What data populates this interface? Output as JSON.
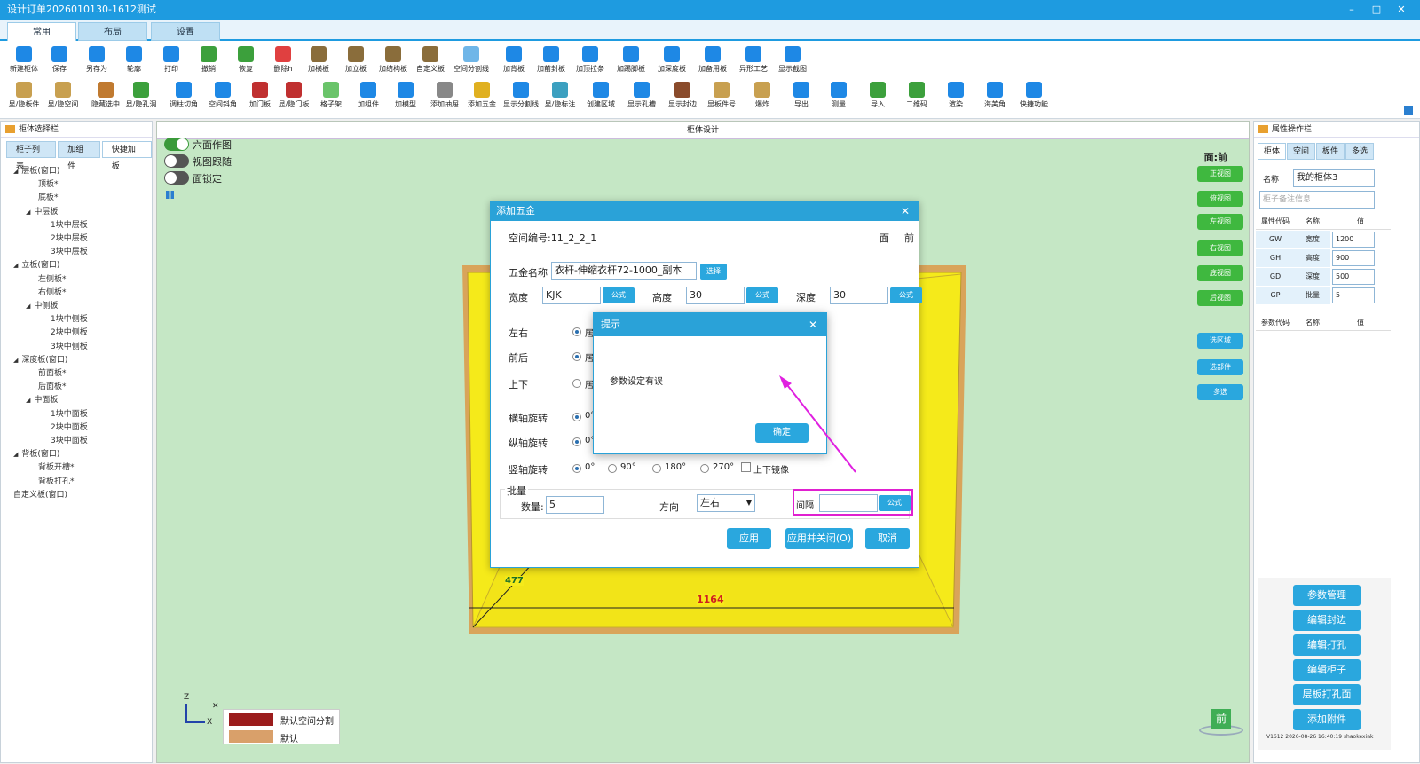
{
  "window": {
    "title": "设计订单2026010130-1612测试",
    "controls": [
      "–",
      "□",
      "✕"
    ]
  },
  "main_tabs": [
    {
      "label": "常用"
    },
    {
      "label": "布局"
    },
    {
      "label": "设置"
    }
  ],
  "toolbar_row1": [
    {
      "label": "新建柜体",
      "icon": "new-cabinet-icon",
      "color": "#1e88e5"
    },
    {
      "label": "保存",
      "icon": "save-icon",
      "color": "#1e88e5"
    },
    {
      "label": "另存为",
      "icon": "save-as-icon",
      "color": "#1e88e5"
    },
    {
      "label": "轮廓",
      "icon": "outline-icon",
      "color": "#1e88e5"
    },
    {
      "label": "打印",
      "icon": "print-icon",
      "color": "#1e88e5"
    },
    {
      "label": "撤销",
      "icon": "undo-icon",
      "color": "#3ca03c"
    },
    {
      "label": "恢复",
      "icon": "redo-icon",
      "color": "#3ca03c"
    },
    {
      "label": "删除h",
      "icon": "delete-icon",
      "color": "#e04040"
    },
    {
      "label": "加横板",
      "icon": "add-shelf-icon",
      "color": "#8a6d3b"
    },
    {
      "label": "加立板",
      "icon": "add-vertical-board-icon",
      "color": "#8a6d3b"
    },
    {
      "label": "加结构板",
      "icon": "add-structure-board-icon",
      "color": "#8a6d3b"
    },
    {
      "label": "自定义板",
      "icon": "custom-board-icon",
      "color": "#8a6d3b"
    },
    {
      "label": "空间分割线",
      "icon": "space-divider-icon",
      "color": "#6fb6e8"
    },
    {
      "label": "加背板",
      "icon": "add-back-panel-icon",
      "color": "#1e88e5"
    },
    {
      "label": "加前封板",
      "icon": "add-front-seal-icon",
      "color": "#1e88e5"
    },
    {
      "label": "加顶拉条",
      "icon": "add-top-strip-icon",
      "color": "#1e88e5"
    },
    {
      "label": "加踢脚板",
      "icon": "add-kickboard-icon",
      "color": "#1e88e5"
    },
    {
      "label": "加深度板",
      "icon": "add-depth-board-icon",
      "color": "#1e88e5"
    },
    {
      "label": "加备用板",
      "icon": "add-spare-board-icon",
      "color": "#1e88e5"
    },
    {
      "label": "异形工艺",
      "icon": "special-process-icon",
      "color": "#1e88e5"
    },
    {
      "label": "显示截图",
      "icon": "screenshot-icon",
      "color": "#1e88e5"
    }
  ],
  "toolbar_row2": [
    {
      "label": "显/隐板件",
      "icon": "toggle-board-icon",
      "color": "#c8a050"
    },
    {
      "label": "显/隐空间",
      "icon": "toggle-space-icon",
      "color": "#c8a050"
    },
    {
      "label": "隐藏选中",
      "icon": "hide-selected-icon",
      "color": "#c07a30"
    },
    {
      "label": "显/隐孔洞",
      "icon": "toggle-holes-icon",
      "color": "#3ca03c"
    },
    {
      "label": "调柱切角",
      "icon": "column-cut-icon",
      "color": "#1e88e5"
    },
    {
      "label": "空间斜角",
      "icon": "space-bevel-icon",
      "color": "#1e88e5"
    },
    {
      "label": "加门板",
      "icon": "add-door-icon",
      "color": "#c03030"
    },
    {
      "label": "显/隐门板",
      "icon": "toggle-door-icon",
      "color": "#c03030"
    },
    {
      "label": "格子架",
      "icon": "grid-rack-icon",
      "color": "#6ac46a"
    },
    {
      "label": "加组件",
      "icon": "add-component-icon",
      "color": "#1e88e5"
    },
    {
      "label": "加模型",
      "icon": "add-model-icon",
      "color": "#1e88e5"
    },
    {
      "label": "添加抽屉",
      "icon": "add-drawer-icon",
      "color": "#888888"
    },
    {
      "label": "添加五金",
      "icon": "add-hardware-icon",
      "color": "#e0b020"
    },
    {
      "label": "显示分割线",
      "icon": "show-divider-icon",
      "color": "#1e88e5"
    },
    {
      "label": "显/隐标注",
      "icon": "toggle-dimension-icon",
      "color": "#3ca0c0"
    },
    {
      "label": "创建区域",
      "icon": "create-region-icon",
      "color": "#1e88e5"
    },
    {
      "label": "显示孔槽",
      "icon": "show-slot-icon",
      "color": "#1e88e5"
    },
    {
      "label": "显示封边",
      "icon": "show-edge-icon",
      "color": "#8a4b2b"
    },
    {
      "label": "显板件号",
      "icon": "board-number-icon",
      "color": "#c8a050"
    },
    {
      "label": "爆炸",
      "icon": "explode-icon",
      "color": "#c8a050"
    },
    {
      "label": "导出",
      "icon": "export-icon",
      "color": "#1e88e5"
    },
    {
      "label": "测量",
      "icon": "measure-icon",
      "color": "#1e88e5"
    },
    {
      "label": "导入",
      "icon": "import-icon",
      "color": "#3ca03c"
    },
    {
      "label": "二维码",
      "icon": "qrcode-icon",
      "color": "#3ca03c"
    },
    {
      "label": "渲染",
      "icon": "render-icon",
      "color": "#1e88e5"
    },
    {
      "label": "海美角",
      "icon": "corner-icon",
      "color": "#1e88e5"
    },
    {
      "label": "快捷功能",
      "icon": "quick-function-icon",
      "color": "#1e88e5"
    }
  ],
  "left_panel": {
    "title": "柜体选择栏",
    "tabs": [
      {
        "label": "柜子列表"
      },
      {
        "label": "加组件"
      },
      {
        "label": "快捷加板"
      }
    ],
    "tree": [
      {
        "label": "层板(窗口)",
        "level": 0,
        "expander": "◢"
      },
      {
        "label": "顶板*",
        "level": 2
      },
      {
        "label": "底板*",
        "level": 2
      },
      {
        "label": "中层板",
        "level": 1,
        "expander": "◢"
      },
      {
        "label": "1块中层板",
        "level": 3
      },
      {
        "label": "2块中层板",
        "level": 3
      },
      {
        "label": "3块中层板",
        "level": 3
      },
      {
        "label": "立板(窗口)",
        "level": 0,
        "expander": "◢"
      },
      {
        "label": "左侧板*",
        "level": 2
      },
      {
        "label": "右侧板*",
        "level": 2
      },
      {
        "label": "中侧板",
        "level": 1,
        "expander": "◢"
      },
      {
        "label": "1块中侧板",
        "level": 3
      },
      {
        "label": "2块中侧板",
        "level": 3
      },
      {
        "label": "3块中侧板",
        "level": 3
      },
      {
        "label": "深度板(窗口)",
        "level": 0,
        "expander": "◢"
      },
      {
        "label": "前面板*",
        "level": 2
      },
      {
        "label": "后面板*",
        "level": 2
      },
      {
        "label": "中面板",
        "level": 1,
        "expander": "◢"
      },
      {
        "label": "1块中面板",
        "level": 3
      },
      {
        "label": "2块中面板",
        "level": 3
      },
      {
        "label": "3块中面板",
        "level": 3
      },
      {
        "label": "背板(窗口)",
        "level": 0,
        "expander": "◢"
      },
      {
        "label": "背板开槽*",
        "level": 2
      },
      {
        "label": "背板打孔*",
        "level": 2
      },
      {
        "label": "自定义板(窗口)",
        "level": 0
      }
    ]
  },
  "canvas": {
    "title": "柜体设计",
    "toggles": [
      {
        "label": "六面作图",
        "on": true
      },
      {
        "label": "视图跟随",
        "on": false
      },
      {
        "label": "面锁定",
        "on": false
      }
    ],
    "face_label": "面:前",
    "view_buttons": [
      {
        "label": "正视图"
      },
      {
        "label": "俯视图"
      },
      {
        "label": "左视图"
      },
      {
        "label": "右视图"
      },
      {
        "label": "底视图"
      },
      {
        "label": "后视图"
      }
    ],
    "select_buttons": [
      {
        "label": "选区域"
      },
      {
        "label": "选部件"
      },
      {
        "label": "多选"
      }
    ],
    "dim_depth": "477",
    "dim_width": "1164",
    "axis": {
      "z": "Z",
      "x": "X"
    },
    "legend": [
      {
        "label": "默认空间分割",
        "color": "#9b1c1c"
      },
      {
        "label": "默认",
        "color": "#d9a06a"
      }
    ],
    "view_cube_label": "前",
    "colors": {
      "cabinet_fill": "#f5ea1a",
      "cabinet_frame": "#d9a45a",
      "background": "#c5e7c5"
    }
  },
  "right_panel": {
    "title": "属性操作栏",
    "tabs": [
      {
        "label": "柜体"
      },
      {
        "label": "空间"
      },
      {
        "label": "板件"
      },
      {
        "label": "多选"
      }
    ],
    "name_label": "名称",
    "name_value": "我的柜体3",
    "remark_placeholder": "柜子备注信息",
    "table_headers": [
      "属性代码",
      "名称",
      "值"
    ],
    "rows": [
      {
        "code": "GW",
        "name": "宽度",
        "value": "1200"
      },
      {
        "code": "GH",
        "name": "高度",
        "value": "900"
      },
      {
        "code": "GD",
        "name": "深度",
        "value": "500"
      },
      {
        "code": "GP",
        "name": "批量",
        "value": "5"
      }
    ],
    "param_headers": [
      "参数代码",
      "名称",
      "值"
    ],
    "buttons": [
      {
        "label": "参数管理"
      },
      {
        "label": "编辑封边"
      },
      {
        "label": "编辑打孔"
      },
      {
        "label": "编辑柜子"
      },
      {
        "label": "层板打孔面"
      },
      {
        "label": "添加附件"
      }
    ],
    "version": "V1612 2026-08-26 16:40:19 shaokexink"
  },
  "dialog": {
    "title": "添加五金",
    "close": "✕",
    "space_no": "空间编号:11_2_2_1",
    "face_label": "面",
    "face_value": "前",
    "hw_name_label": "五金名称",
    "hw_name_value": "衣杆-伸缩衣杆72-1000_副本",
    "select_btn": "选择",
    "width_label": "宽度",
    "width_value": "KJK",
    "height_label": "高度",
    "height_value": "30",
    "depth_label": "深度",
    "depth_value": "30",
    "formula_btn": "公式",
    "lr_label": "左右",
    "fb_label": "前后",
    "ud_label": "上下",
    "pos_option": "居",
    "hrot_label": "横轴旋转",
    "vrot_label": "纵轴旋转",
    "zrot_label": "竖轴旋转",
    "angles": [
      "0°",
      "90°",
      "180°",
      "270°"
    ],
    "mirror_label": "上下镜像",
    "batch_label": "批量",
    "qty_label": "数量:",
    "qty_value": "5",
    "dir_label": "方向",
    "dir_value": "左右",
    "gap_label": "间隔",
    "gap_value": "",
    "highlight_color": "#e020d0",
    "buttons": [
      {
        "label": "应用"
      },
      {
        "label": "应用并关闭(O)"
      },
      {
        "label": "取消"
      }
    ]
  },
  "popup": {
    "title": "提示",
    "close": "✕",
    "message": "参数设定有误",
    "ok": "确定"
  }
}
